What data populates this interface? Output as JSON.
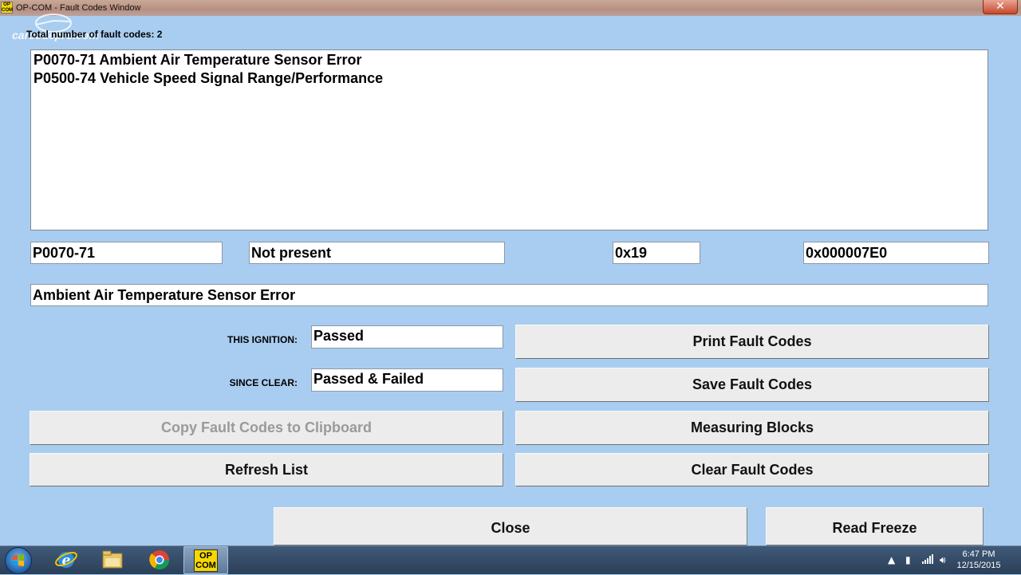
{
  "window": {
    "title": "OP-COM - Fault Codes Window",
    "icon_text": "OP COM",
    "close_glyph": "✕"
  },
  "watermark": "carcodepro.com",
  "total_label": "Total number of fault codes:  2",
  "fault_list": [
    "P0070-71 Ambient Air Temperature Sensor Error",
    "P0500-74 Vehicle Speed Signal Range/Performance"
  ],
  "details": {
    "code": "P0070-71",
    "status": "Not present",
    "hex1": "0x19",
    "hex2": "0x000007E0",
    "description": "Ambient Air Temperature Sensor Error"
  },
  "ignition": {
    "label": "THIS IGNITION:",
    "value": "Passed"
  },
  "since_clear": {
    "label": "SINCE CLEAR:",
    "value": "Passed & Failed"
  },
  "buttons": {
    "copy": "Copy Fault Codes to Clipboard",
    "refresh": "Refresh List",
    "print": "Print Fault Codes",
    "save": "Save Fault Codes",
    "measuring": "Measuring Blocks",
    "clear": "Clear Fault Codes",
    "close": "Close",
    "read_freeze": "Read Freeze"
  },
  "taskbar": {
    "apps": [
      "start-button",
      "internet-explorer-icon",
      "file-explorer-icon",
      "chrome-icon",
      "opcom-icon"
    ],
    "opcom_label": "OP COM",
    "time": "6:47 PM",
    "date": "12/15/2015"
  },
  "colors": {
    "window_bg": "#a9cdf0",
    "button_bg": "#ececec",
    "opcom_yellow": "#f5d800"
  }
}
